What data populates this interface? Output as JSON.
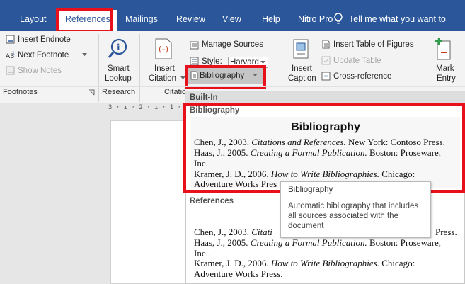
{
  "tabs": {
    "layout": "Layout",
    "references": "References",
    "mailings": "Mailings",
    "review": "Review",
    "view": "View",
    "help": "Help",
    "nitro": "Nitro Pro",
    "tell_me": "Tell me what you want to"
  },
  "ribbon": {
    "footnotes": {
      "insert_endnote": "Insert Endnote",
      "next_footnote": "Next Footnote",
      "show_notes": "Show Notes",
      "group_label": "Footnotes"
    },
    "research": {
      "smart": "Smart",
      "lookup": "Lookup",
      "group_label": "Research"
    },
    "citations": {
      "insert": "Insert",
      "citation": "Citation",
      "manage_sources": "Manage Sources",
      "style_label": "Style:",
      "style_value": "Harvard",
      "bibliography": "Bibliography",
      "group_label": "Citatic"
    },
    "captions": {
      "insert_table_of_figures": "Insert Table of Figures",
      "update_table": "Update Table",
      "insert": "Insert",
      "caption": "Caption",
      "cross_reference": "Cross-reference"
    },
    "index": {
      "mark": "Mark",
      "entry": "Entry"
    }
  },
  "ruler": "3 · ı · 2 · ı · 1 ·",
  "gallery": {
    "builtin": "Built-In",
    "section1": "Bibliography",
    "preview_title": "Bibliography",
    "entries1": {
      "e1a": "Chen, J., 2003. ",
      "e1b": "Citations and References.",
      "e1c": " New York: Contoso Press.",
      "e2a": "Haas, J., 2005. ",
      "e2b": "Creating a Formal Publication.",
      "e2c": " Boston: Proseware,",
      "e2d": "Inc..",
      "e3a": "Kramer, J. D., 2006. ",
      "e3b": "How to Write Bibliographies.",
      "e3c": " Chicago:",
      "e3d": "Adventure Works Pres"
    },
    "section2": "References",
    "entries2": {
      "e1a": "Chen, J., 2003. ",
      "e1b": "Citati",
      "e1c": "Press.",
      "e2a": "Haas, J., 2005. ",
      "e2b": "Creating a Formal Publication.",
      "e2c": " Boston: Proseware,",
      "e2d": "Inc..",
      "e3a": "Kramer, J. D., 2006. ",
      "e3b": "How to Write Bibliographies.",
      "e3c": " Chicago:",
      "e3d": "Adventure Works Press."
    }
  },
  "tooltip": {
    "title": "Bibliography",
    "body": "Automatic bibliography that includes all sources associated with the document"
  },
  "colors": {
    "ribbon_blue": "#2b579a",
    "highlight_red": "#e8101a"
  }
}
